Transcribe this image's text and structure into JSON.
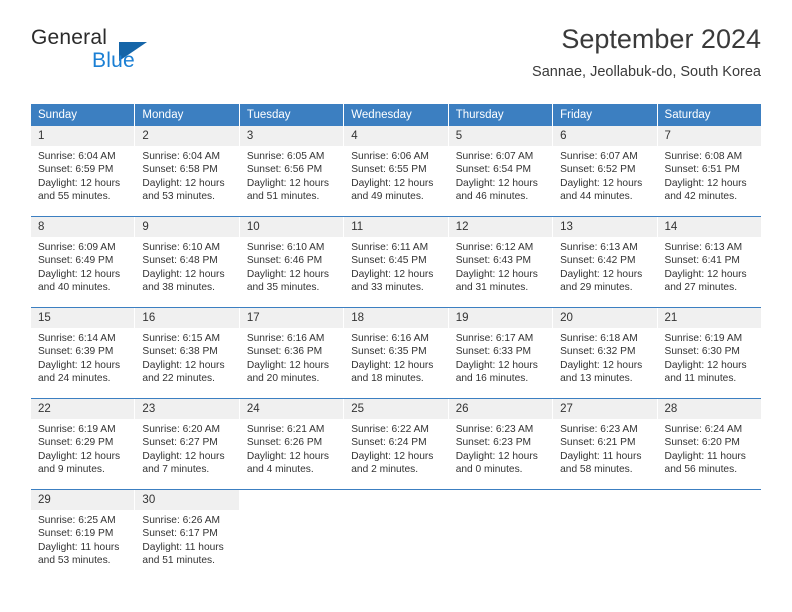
{
  "logo": {
    "word_top": "General",
    "word_bottom": "Blue",
    "triangle": "blue-triangle-icon",
    "accent_color": "#1a7fd4"
  },
  "header": {
    "title": "September 2024",
    "location": "Sannae, Jeollabuk-do, South Korea"
  },
  "calendar": {
    "header_color": "#3c7fc1",
    "weekdays": [
      "Sunday",
      "Monday",
      "Tuesday",
      "Wednesday",
      "Thursday",
      "Friday",
      "Saturday"
    ],
    "weeks": [
      [
        {
          "day": "1",
          "sunrise": "Sunrise: 6:04 AM",
          "sunset": "Sunset: 6:59 PM",
          "daylight1": "Daylight: 12 hours",
          "daylight2": "and 55 minutes."
        },
        {
          "day": "2",
          "sunrise": "Sunrise: 6:04 AM",
          "sunset": "Sunset: 6:58 PM",
          "daylight1": "Daylight: 12 hours",
          "daylight2": "and 53 minutes."
        },
        {
          "day": "3",
          "sunrise": "Sunrise: 6:05 AM",
          "sunset": "Sunset: 6:56 PM",
          "daylight1": "Daylight: 12 hours",
          "daylight2": "and 51 minutes."
        },
        {
          "day": "4",
          "sunrise": "Sunrise: 6:06 AM",
          "sunset": "Sunset: 6:55 PM",
          "daylight1": "Daylight: 12 hours",
          "daylight2": "and 49 minutes."
        },
        {
          "day": "5",
          "sunrise": "Sunrise: 6:07 AM",
          "sunset": "Sunset: 6:54 PM",
          "daylight1": "Daylight: 12 hours",
          "daylight2": "and 46 minutes."
        },
        {
          "day": "6",
          "sunrise": "Sunrise: 6:07 AM",
          "sunset": "Sunset: 6:52 PM",
          "daylight1": "Daylight: 12 hours",
          "daylight2": "and 44 minutes."
        },
        {
          "day": "7",
          "sunrise": "Sunrise: 6:08 AM",
          "sunset": "Sunset: 6:51 PM",
          "daylight1": "Daylight: 12 hours",
          "daylight2": "and 42 minutes."
        }
      ],
      [
        {
          "day": "8",
          "sunrise": "Sunrise: 6:09 AM",
          "sunset": "Sunset: 6:49 PM",
          "daylight1": "Daylight: 12 hours",
          "daylight2": "and 40 minutes."
        },
        {
          "day": "9",
          "sunrise": "Sunrise: 6:10 AM",
          "sunset": "Sunset: 6:48 PM",
          "daylight1": "Daylight: 12 hours",
          "daylight2": "and 38 minutes."
        },
        {
          "day": "10",
          "sunrise": "Sunrise: 6:10 AM",
          "sunset": "Sunset: 6:46 PM",
          "daylight1": "Daylight: 12 hours",
          "daylight2": "and 35 minutes."
        },
        {
          "day": "11",
          "sunrise": "Sunrise: 6:11 AM",
          "sunset": "Sunset: 6:45 PM",
          "daylight1": "Daylight: 12 hours",
          "daylight2": "and 33 minutes."
        },
        {
          "day": "12",
          "sunrise": "Sunrise: 6:12 AM",
          "sunset": "Sunset: 6:43 PM",
          "daylight1": "Daylight: 12 hours",
          "daylight2": "and 31 minutes."
        },
        {
          "day": "13",
          "sunrise": "Sunrise: 6:13 AM",
          "sunset": "Sunset: 6:42 PM",
          "daylight1": "Daylight: 12 hours",
          "daylight2": "and 29 minutes."
        },
        {
          "day": "14",
          "sunrise": "Sunrise: 6:13 AM",
          "sunset": "Sunset: 6:41 PM",
          "daylight1": "Daylight: 12 hours",
          "daylight2": "and 27 minutes."
        }
      ],
      [
        {
          "day": "15",
          "sunrise": "Sunrise: 6:14 AM",
          "sunset": "Sunset: 6:39 PM",
          "daylight1": "Daylight: 12 hours",
          "daylight2": "and 24 minutes."
        },
        {
          "day": "16",
          "sunrise": "Sunrise: 6:15 AM",
          "sunset": "Sunset: 6:38 PM",
          "daylight1": "Daylight: 12 hours",
          "daylight2": "and 22 minutes."
        },
        {
          "day": "17",
          "sunrise": "Sunrise: 6:16 AM",
          "sunset": "Sunset: 6:36 PM",
          "daylight1": "Daylight: 12 hours",
          "daylight2": "and 20 minutes."
        },
        {
          "day": "18",
          "sunrise": "Sunrise: 6:16 AM",
          "sunset": "Sunset: 6:35 PM",
          "daylight1": "Daylight: 12 hours",
          "daylight2": "and 18 minutes."
        },
        {
          "day": "19",
          "sunrise": "Sunrise: 6:17 AM",
          "sunset": "Sunset: 6:33 PM",
          "daylight1": "Daylight: 12 hours",
          "daylight2": "and 16 minutes."
        },
        {
          "day": "20",
          "sunrise": "Sunrise: 6:18 AM",
          "sunset": "Sunset: 6:32 PM",
          "daylight1": "Daylight: 12 hours",
          "daylight2": "and 13 minutes."
        },
        {
          "day": "21",
          "sunrise": "Sunrise: 6:19 AM",
          "sunset": "Sunset: 6:30 PM",
          "daylight1": "Daylight: 12 hours",
          "daylight2": "and 11 minutes."
        }
      ],
      [
        {
          "day": "22",
          "sunrise": "Sunrise: 6:19 AM",
          "sunset": "Sunset: 6:29 PM",
          "daylight1": "Daylight: 12 hours",
          "daylight2": "and 9 minutes."
        },
        {
          "day": "23",
          "sunrise": "Sunrise: 6:20 AM",
          "sunset": "Sunset: 6:27 PM",
          "daylight1": "Daylight: 12 hours",
          "daylight2": "and 7 minutes."
        },
        {
          "day": "24",
          "sunrise": "Sunrise: 6:21 AM",
          "sunset": "Sunset: 6:26 PM",
          "daylight1": "Daylight: 12 hours",
          "daylight2": "and 4 minutes."
        },
        {
          "day": "25",
          "sunrise": "Sunrise: 6:22 AM",
          "sunset": "Sunset: 6:24 PM",
          "daylight1": "Daylight: 12 hours",
          "daylight2": "and 2 minutes."
        },
        {
          "day": "26",
          "sunrise": "Sunrise: 6:23 AM",
          "sunset": "Sunset: 6:23 PM",
          "daylight1": "Daylight: 12 hours",
          "daylight2": "and 0 minutes."
        },
        {
          "day": "27",
          "sunrise": "Sunrise: 6:23 AM",
          "sunset": "Sunset: 6:21 PM",
          "daylight1": "Daylight: 11 hours",
          "daylight2": "and 58 minutes."
        },
        {
          "day": "28",
          "sunrise": "Sunrise: 6:24 AM",
          "sunset": "Sunset: 6:20 PM",
          "daylight1": "Daylight: 11 hours",
          "daylight2": "and 56 minutes."
        }
      ],
      [
        {
          "day": "29",
          "sunrise": "Sunrise: 6:25 AM",
          "sunset": "Sunset: 6:19 PM",
          "daylight1": "Daylight: 11 hours",
          "daylight2": "and 53 minutes."
        },
        {
          "day": "30",
          "sunrise": "Sunrise: 6:26 AM",
          "sunset": "Sunset: 6:17 PM",
          "daylight1": "Daylight: 11 hours",
          "daylight2": "and 51 minutes."
        },
        {
          "day": "",
          "sunrise": "",
          "sunset": "",
          "daylight1": "",
          "daylight2": ""
        },
        {
          "day": "",
          "sunrise": "",
          "sunset": "",
          "daylight1": "",
          "daylight2": ""
        },
        {
          "day": "",
          "sunrise": "",
          "sunset": "",
          "daylight1": "",
          "daylight2": ""
        },
        {
          "day": "",
          "sunrise": "",
          "sunset": "",
          "daylight1": "",
          "daylight2": ""
        },
        {
          "day": "",
          "sunrise": "",
          "sunset": "",
          "daylight1": "",
          "daylight2": ""
        }
      ]
    ]
  }
}
